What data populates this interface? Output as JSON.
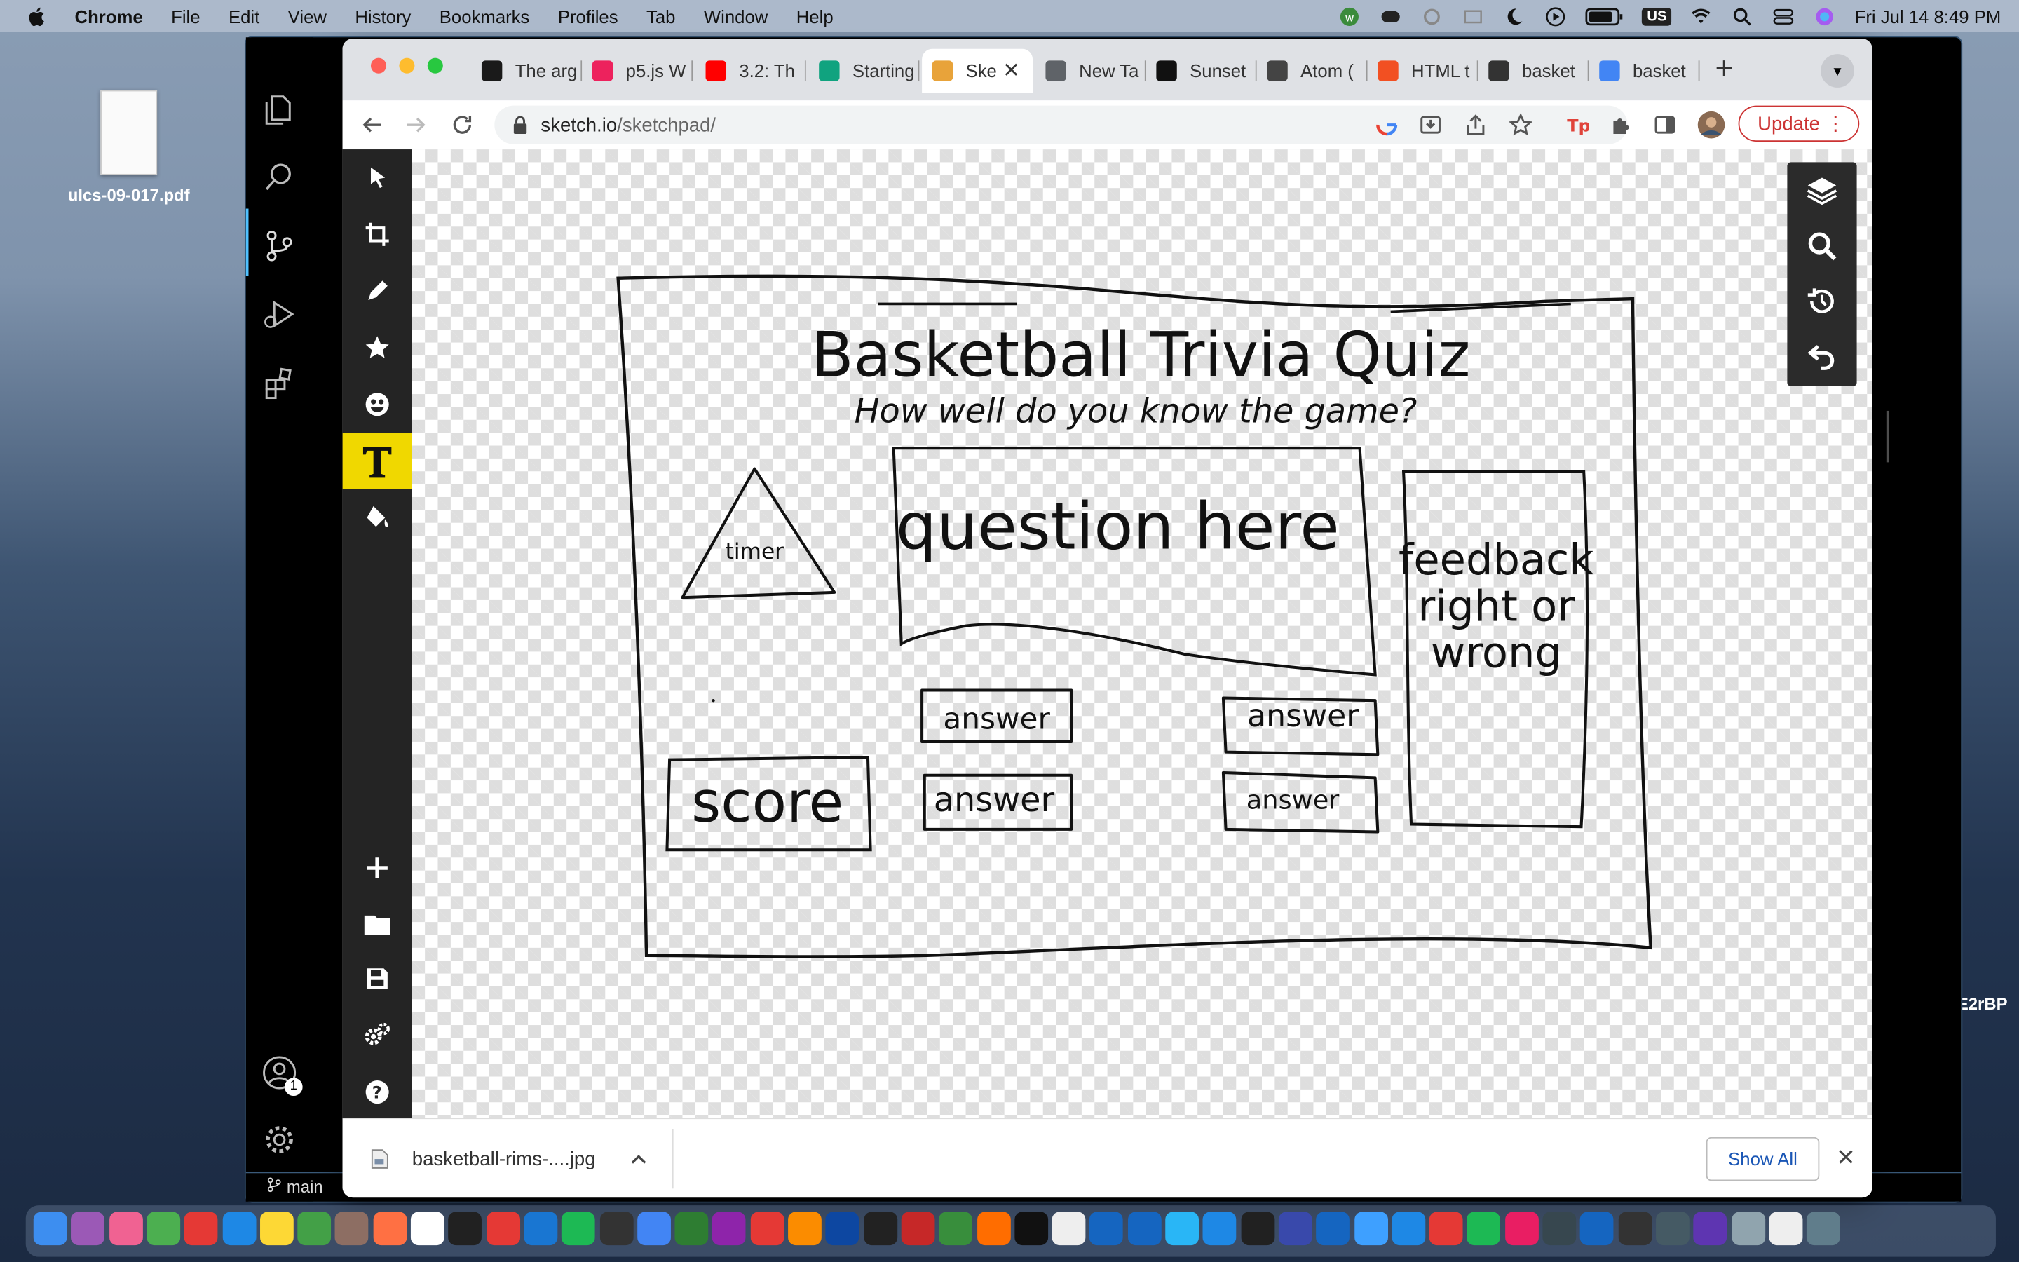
{
  "menubar": {
    "app": "Chrome",
    "items": [
      "File",
      "Edit",
      "View",
      "History",
      "Bookmarks",
      "Profiles",
      "Tab",
      "Window",
      "Help"
    ],
    "input_source": "US",
    "datetime": "Fri Jul 14  8:49 PM"
  },
  "desktop": {
    "file_name": "ulcs-09-017.pdf",
    "side_label": "E2rBP"
  },
  "editor": {
    "branch": "main",
    "account_badge": "1"
  },
  "browser": {
    "tabs": [
      {
        "title": "The arg",
        "color": "#1a1a1a"
      },
      {
        "title": "p5.js W",
        "color": "#ed225d"
      },
      {
        "title": "3.2: Th",
        "color": "#ff0000"
      },
      {
        "title": "Starting",
        "color": "#10a37f"
      },
      {
        "title": "Ske",
        "color": "#e8a33a",
        "active": true
      },
      {
        "title": "New Ta",
        "color": "#5f6368"
      },
      {
        "title": "Sunset",
        "color": "#111111"
      },
      {
        "title": "Atom (",
        "color": "#444444"
      },
      {
        "title": "HTML t",
        "color": "#f25022"
      },
      {
        "title": "basket",
        "color": "#333333"
      },
      {
        "title": "basket",
        "color": "#4285f4"
      }
    ],
    "url_domain": "sketch.io",
    "url_path": "/sketchpad/",
    "update_label": "Update",
    "download_file": "basketball-rims-....jpg",
    "show_all_label": "Show All"
  },
  "sketch": {
    "title": "Basketball Trivia Quiz",
    "subtitle": "How well do you know the game?",
    "timer": "timer",
    "question": "question here",
    "feedback_lines": [
      "feedback",
      "right or",
      "wrong"
    ],
    "score": "score",
    "answers": [
      "answer",
      "answer",
      "answer",
      "answer"
    ]
  },
  "sidebar_tools": [
    "pointer-tool",
    "crop-tool",
    "pencil-tool",
    "stamp-tool",
    "emoji-tool",
    "text-tool",
    "fill-tool"
  ],
  "sidebar_actions": [
    "add",
    "open-folder",
    "save",
    "settings",
    "help"
  ],
  "active_tool": "text-tool"
}
